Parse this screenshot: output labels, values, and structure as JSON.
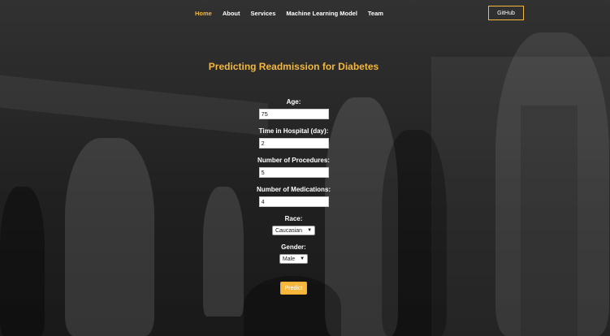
{
  "nav": {
    "items": [
      {
        "label": "Home",
        "active": true
      },
      {
        "label": "About"
      },
      {
        "label": "Services"
      },
      {
        "label": "Machine Learning Model"
      },
      {
        "label": "Team"
      }
    ],
    "github_label": "GitHub"
  },
  "page": {
    "title": "Predicting Readmission for Diabetes"
  },
  "form": {
    "age": {
      "label": "Age:",
      "value": "75"
    },
    "time_in_hospital": {
      "label": "Time in Hospital (day):",
      "value": "2"
    },
    "num_procedures": {
      "label": "Number of Procedures:",
      "value": "5"
    },
    "num_medications": {
      "label": "Number of Medications:",
      "value": "4"
    },
    "race": {
      "label": "Race:",
      "selected": "Caucasian"
    },
    "gender": {
      "label": "Gender:",
      "selected": "Male"
    },
    "predict_label": "Predict"
  },
  "colors": {
    "accent": "#f5b83d",
    "text": "#ffffff"
  }
}
